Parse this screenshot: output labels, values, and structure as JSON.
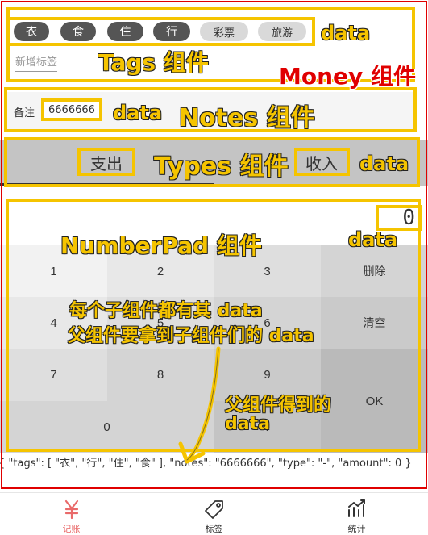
{
  "tags": {
    "items": [
      {
        "label": "衣",
        "selected": true
      },
      {
        "label": "食",
        "selected": true
      },
      {
        "label": "住",
        "selected": true
      },
      {
        "label": "行",
        "selected": true
      },
      {
        "label": "彩票",
        "selected": false
      },
      {
        "label": "旅游",
        "selected": false
      }
    ],
    "add_label": "新增标签"
  },
  "notes": {
    "label": "备注",
    "value": "6666666"
  },
  "types": {
    "expense_label": "支出",
    "income_label": "收入",
    "selected": "expense"
  },
  "number_pad": {
    "output": "0",
    "keys": {
      "k1": "1",
      "k2": "2",
      "k3": "3",
      "delete": "删除",
      "k4": "4",
      "k5": "5",
      "k6": "6",
      "clear": "清空",
      "k7": "7",
      "k8": "8",
      "k9": "9",
      "ok": "OK",
      "k0": "0",
      "dot": "."
    }
  },
  "record_dump": "{ \"tags\": [ \"衣\", \"行\", \"住\", \"食\" ], \"notes\": \"6666666\", \"type\": \"-\", \"amount\": 0 }",
  "nav": {
    "items": [
      {
        "label": "记账",
        "icon": "yuan-icon",
        "active": true
      },
      {
        "label": "标签",
        "icon": "tag-icon",
        "active": false
      },
      {
        "label": "统计",
        "icon": "chart-icon",
        "active": false
      }
    ],
    "active_color": "#e96a6a",
    "inactive_color": "#333333"
  },
  "annotations": {
    "tags_data": "data",
    "tags_component": "Tags 组件",
    "money_component": "Money 组件",
    "notes_data": "data",
    "notes_component": "Notes 组件",
    "types_component": "Types 组件",
    "types_data": "data",
    "numberpad_component": "NumberPad 组件",
    "numberpad_data": "data",
    "explain_line1": "每个子组件都有其 data",
    "explain_line2": "父组件要拿到子组件们的 data",
    "parent_line1": "父组件得到的",
    "parent_line2": "data"
  },
  "colors": {
    "highlight": "#f5c400",
    "money_border": "#e00000",
    "money_label": "#e00000"
  }
}
